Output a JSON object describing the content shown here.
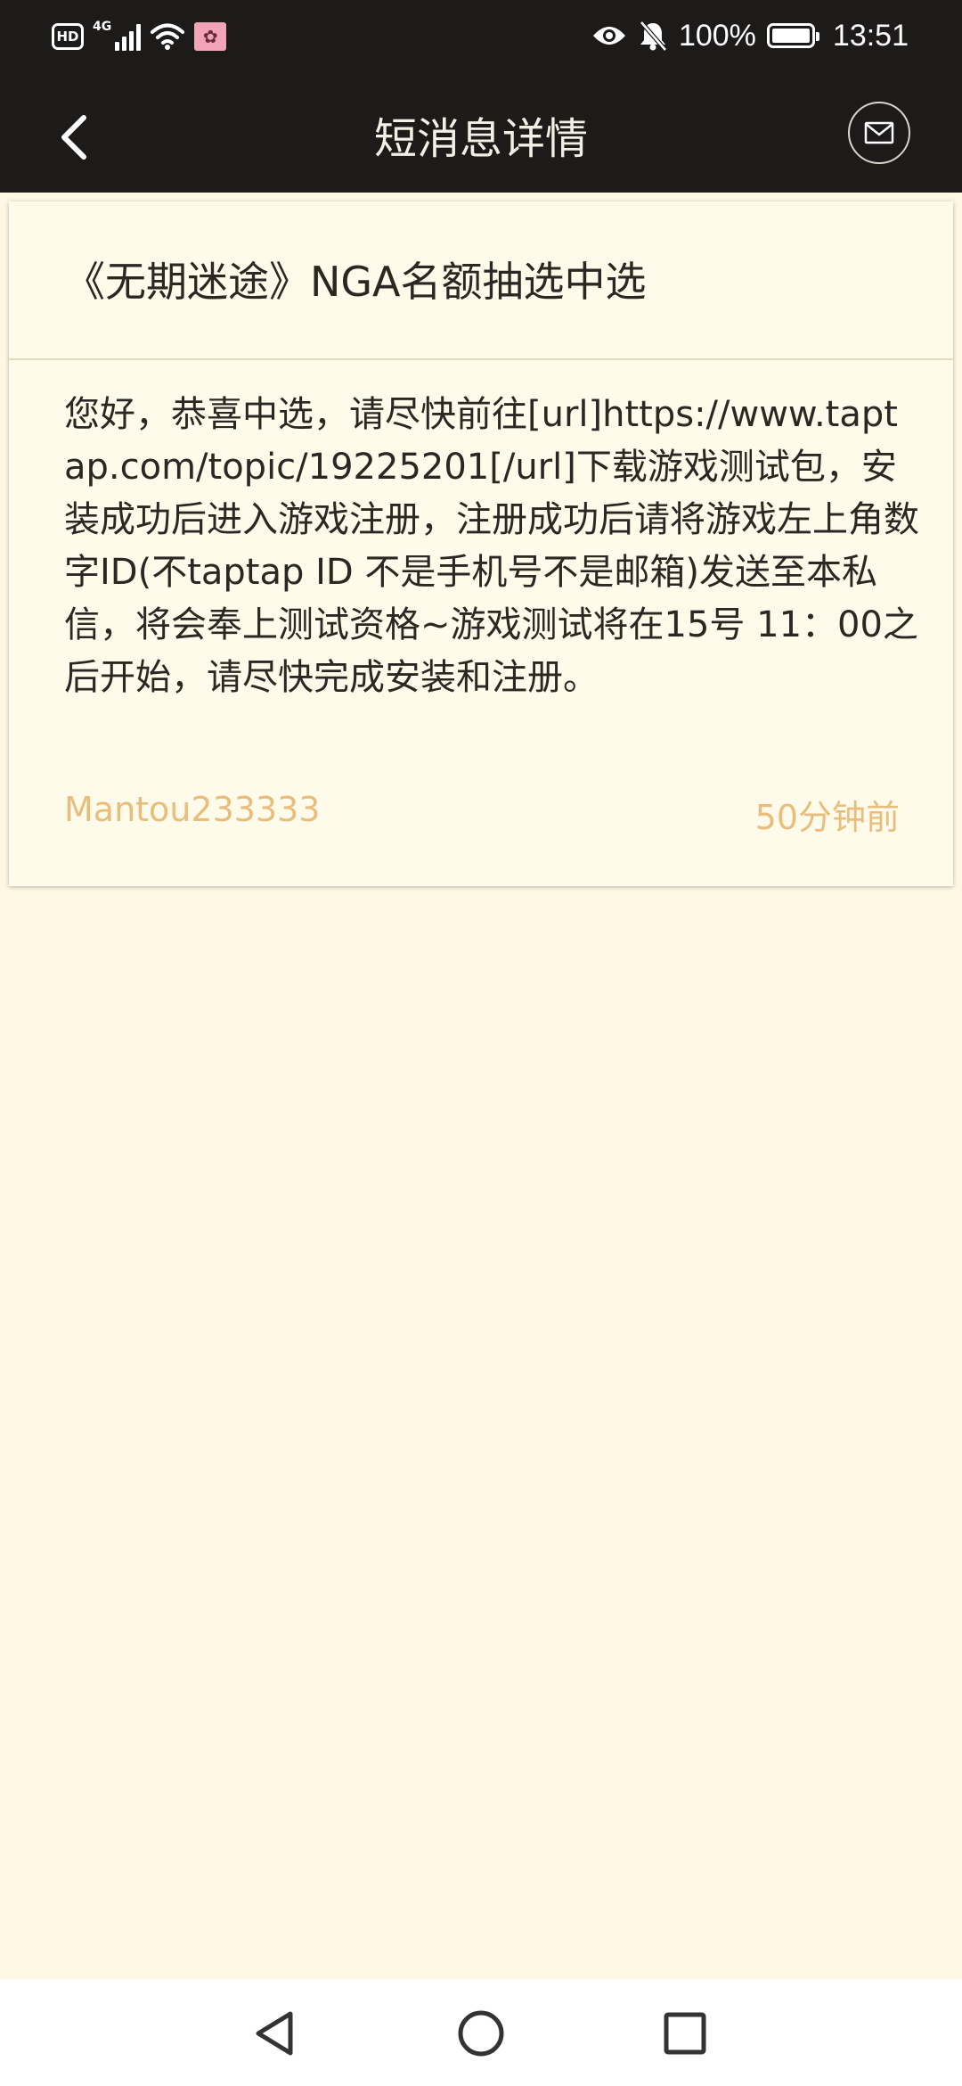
{
  "status_bar": {
    "hd_label": "HD",
    "network_label": "4G",
    "battery_level": "100%",
    "battery_fraction": 1.0,
    "time": "13:51",
    "icons": [
      "hd-icon",
      "signal-icon",
      "wifi-icon",
      "app-notification-icon",
      "eye-icon",
      "bell-off-icon",
      "battery-icon"
    ]
  },
  "header": {
    "title": "短消息详情",
    "back_icon": "chevron-left-icon",
    "action_icon": "envelope-icon"
  },
  "message": {
    "subject": "《无期迷途》NGA名额抽选中选",
    "body": "您好，恭喜中选，请尽快前往[url]https://www.taptap.com/topic/19225201[/url]下载游戏测试包，安装成功后进入游戏注册，注册成功后请将游戏左上角数字ID(不taptap ID 不是手机号不是邮箱)发送至本私信，将会奉上测试资格~游戏测试将在15号 11：00之后开始，请尽快完成安装和注册。",
    "sender": "Mantou233333",
    "time": "50分钟前"
  },
  "nav_bar": {
    "icons": [
      "nav-back-icon",
      "nav-home-icon",
      "nav-recents-icon"
    ]
  },
  "colors": {
    "bar_background": "#1d1a1a",
    "page_background": "#fef8e4",
    "card_background": "#fefbea",
    "text_primary": "#2b2823",
    "accent": "#e9be7c"
  }
}
